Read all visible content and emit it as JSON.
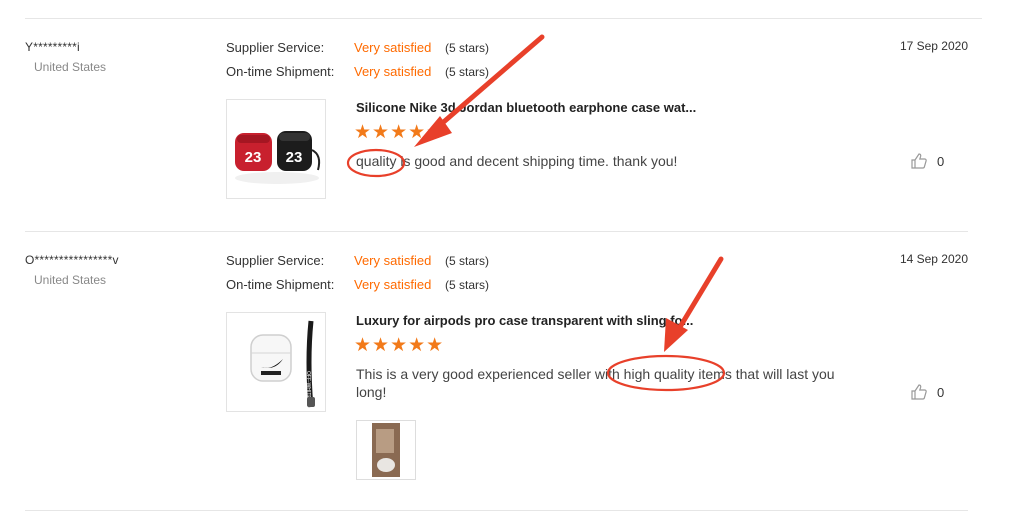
{
  "reviews": [
    {
      "buyer": "Y*********i",
      "country": "United States",
      "supplier_label": "Supplier Service:",
      "supplier_value": "Very satisfied",
      "supplier_stars": "(5 stars)",
      "shipment_label": "On-time Shipment:",
      "shipment_value": "Very satisfied",
      "shipment_stars": "(5 stars)",
      "date": "17 Sep 2020",
      "product_title": "Silicone Nike 3d Jordan bluetooth earphone case wat...",
      "stars": "★★★★★",
      "rating": 5,
      "text": "quality is good and decent shipping time. thank you!",
      "likes": "0",
      "product_image_text": [
        "23",
        "23"
      ]
    },
    {
      "buyer": "O****************v",
      "country": "United States",
      "supplier_label": "Supplier Service:",
      "supplier_value": "Very satisfied",
      "supplier_stars": "(5 stars)",
      "shipment_label": "On-time Shipment:",
      "shipment_value": "Very satisfied",
      "shipment_stars": "(5 stars)",
      "date": "14 Sep 2020",
      "product_title": "Luxury for airpods pro case transparent with sling fo...",
      "stars": "★★★★★",
      "rating": 5,
      "text": "This is a very good experienced seller with high quality items that will last you long!",
      "likes": "0",
      "product_image_text": [
        "OFF-WHITE"
      ]
    }
  ],
  "colors": {
    "accent": "#ff6a00",
    "star": "#f27a1a",
    "annotation": "#e8402a"
  }
}
